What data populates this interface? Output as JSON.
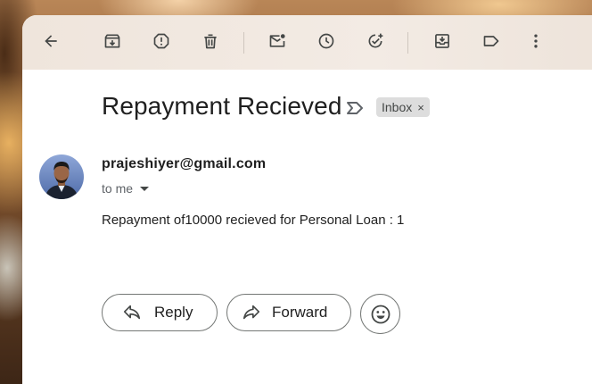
{
  "toolbar": {
    "icons": [
      "back-arrow-icon",
      "archive-icon",
      "report-spam-icon",
      "delete-icon",
      "mark-unread-icon",
      "snooze-icon",
      "add-to-tasks-icon",
      "move-to-icon",
      "label-icon",
      "more-options-icon"
    ]
  },
  "email": {
    "subject": "Repayment Recieved",
    "label_chip": "Inbox",
    "label_chip_close": "×",
    "sender": "prajeshiyer@gmail.com",
    "recipient": "to me",
    "body": "Repayment of10000 recieved for Personal Loan : 1"
  },
  "actions": {
    "reply_label": "Reply",
    "forward_label": "Forward"
  },
  "colors": {
    "toolbar_bg": "#efe5dc",
    "icon": "#444746",
    "chip_bg": "#dddddd",
    "text": "#1f1f1f"
  }
}
